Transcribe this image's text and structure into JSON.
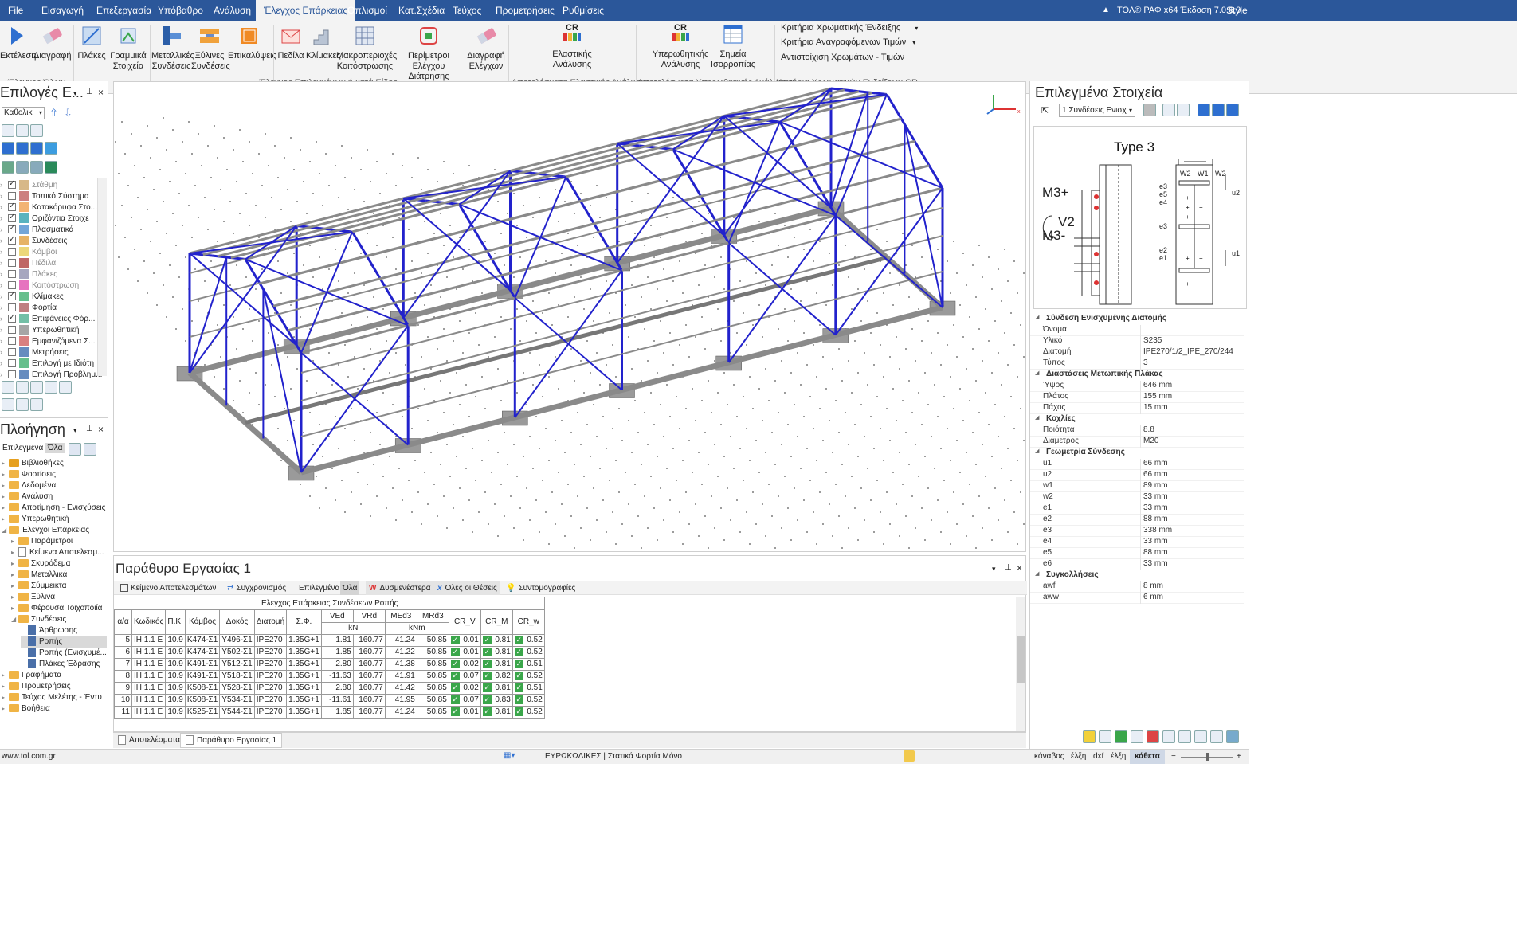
{
  "menu": {
    "items": [
      "File",
      "Εισαγωγή",
      "Επεξεργασία",
      "Υπόβαθρο",
      "Ανάλυση",
      "Έλεγχος Επάρκειας",
      "Οπλισμοί",
      "Κατ.Σχέδια",
      "Τεύχος",
      "Προμετρήσεις",
      "Ρυθμίσεις"
    ],
    "active": "Έλεγχος Επάρκειας",
    "right_title": "ΤΟΛ® ΡΑΦ x64 Έκδοση 7.0.6.0",
    "style_label": "Style"
  },
  "ribbon": {
    "buttons": {
      "run": "Εκτέλεση",
      "delete": "Διαγραφή",
      "slabs": "Πλάκες",
      "linear": "Γραμμικά Στοιχεία",
      "metal_conn": "Μεταλλικές Συνδέσεις",
      "wood_conn": "Ξύλινες Συνδέσεις",
      "overlaps": "Επικαλύψεις",
      "pedila": "Πεδίλα",
      "stairs": "Κλίμακες",
      "macro": "Μακροπεριοχές Κοιτόστρωσης",
      "perimeter": "Περίμετροι Ελέγχου Διάτρησης",
      "delete_checks": "Διαγραφή Ελέγχων",
      "elastic": "Ελαστικής Ανάλυσης",
      "inelastic": "Υπερωθητικής Ανάλυσης",
      "balance": "Σημεία Ισορροπίας"
    },
    "cr_label": "CR",
    "groups": {
      "check_all": "Έλεγχος Όλων",
      "check_selected": "Έλεγχος Επιλεγμένων ή κατά Είδος",
      "elastic_results": "Αποτελέσματα Ελαστικής Ανάλυσης",
      "inelastic_results": "Αποτελέσματα Υπερωθητικής Ανάλυσης",
      "cr_criteria": "Κριτήρια Χρωματικών Ενδείξεων CR"
    },
    "cr_links": [
      "Κριτήρια Χρωματικής Ένδειξης",
      "Κριτήρια Αναγραφόμενων Τιμών",
      "Αντιστοίχιση Χρωμάτων - Τιμών"
    ]
  },
  "left_top": {
    "title": "Επιλογές Ε...",
    "combo": "Καθολικ",
    "layers": [
      {
        "label": "Στάθμη",
        "checked": true,
        "dim": true
      },
      {
        "label": "Τοπικό Σύστημα",
        "checked": false,
        "dim": false
      },
      {
        "label": "Κατακόρυφα Στο...",
        "checked": true,
        "dim": false
      },
      {
        "label": "Οριζόντια Στοιχε",
        "checked": true,
        "dim": false
      },
      {
        "label": "Πλασματικά",
        "checked": true,
        "dim": false
      },
      {
        "label": "Συνδέσεις",
        "checked": true,
        "dim": false
      },
      {
        "label": "Κόμβοι",
        "checked": false,
        "dim": true
      },
      {
        "label": "Πέδιλα",
        "checked": false,
        "dim": true
      },
      {
        "label": "Πλάκες",
        "checked": false,
        "dim": true
      },
      {
        "label": "Κοιτόστρωση",
        "checked": false,
        "dim": true
      },
      {
        "label": "Κλίμακες",
        "checked": true,
        "dim": false
      },
      {
        "label": "Φορτία",
        "checked": false,
        "dim": false
      },
      {
        "label": "Επιφάνειες Φόρ...",
        "checked": true,
        "dim": false
      },
      {
        "label": "Υπερωθητική",
        "checked": false,
        "dim": false
      },
      {
        "label": "Εμφανιζόμενα Σ...",
        "checked": false,
        "dim": false
      },
      {
        "label": "Μετρήσεις",
        "checked": false,
        "dim": false
      },
      {
        "label": "Επιλογή με Ιδιότη",
        "checked": false,
        "dim": false
      },
      {
        "label": "Επιλογή Προβλημ...",
        "checked": false,
        "dim": false
      }
    ]
  },
  "nav": {
    "title": "Πλοήγηση",
    "tab_selected": "Επιλεγμένα",
    "tab_all": "Όλα",
    "items": [
      {
        "label": "Βιβλιοθήκες",
        "lvl": 0
      },
      {
        "label": "Φορτίσεις",
        "lvl": 0
      },
      {
        "label": "Δεδομένα",
        "lvl": 0
      },
      {
        "label": "Ανάλυση",
        "lvl": 0
      },
      {
        "label": "Αποτίμηση - Ενισχύσεις",
        "lvl": 0
      },
      {
        "label": "Υπερωθητική",
        "lvl": 0
      },
      {
        "label": "Έλεγχοι Επάρκειας",
        "lvl": 0
      },
      {
        "label": "Παράμετροι",
        "lvl": 1
      },
      {
        "label": "Κείμενα Αποτελεσμ...",
        "lvl": 1
      },
      {
        "label": "Σκυρόδεμα",
        "lvl": 1
      },
      {
        "label": "Μεταλλικά",
        "lvl": 1
      },
      {
        "label": "Σύμμεικτα",
        "lvl": 1
      },
      {
        "label": "Ξύλινα",
        "lvl": 1
      },
      {
        "label": "Φέρουσα Τοιχοποιία",
        "lvl": 1
      },
      {
        "label": "Συνδέσεις",
        "lvl": 1
      },
      {
        "label": "Άρθρωσης",
        "lvl": 2
      },
      {
        "label": "Ροπής",
        "lvl": 2
      },
      {
        "label": "Ροπής (Ενισχυμέ...",
        "lvl": 2
      },
      {
        "label": "Πλάκες Έδρασης",
        "lvl": 2
      },
      {
        "label": "Γραφήματα",
        "lvl": 0
      },
      {
        "label": "Προμετρήσεις",
        "lvl": 0
      },
      {
        "label": "Τεύχος Μελέτης - Έντυ",
        "lvl": 0
      },
      {
        "label": "Βοήθεια",
        "lvl": 0
      }
    ]
  },
  "work": {
    "title": "Παράθυρο Εργασίας 1",
    "toolbar": [
      "Κείμενο Αποτελεσμάτων",
      "Συγχρονισμός",
      "Επιλεγμένα",
      "Όλα",
      "Δυσμενέστερα",
      "Όλες οι Θέσεις",
      "Συντομογραφίες"
    ],
    "table_title": "Έλεγχος Επάρκειας Συνδέσεων Ροπής",
    "headers": [
      "α/α",
      "Κωδικός",
      "Π.Κ.",
      "Κόμβος",
      "Δοκός",
      "Διατομή",
      "Σ.Φ.",
      "VEd",
      "VRd",
      "MEd3",
      "MRd3",
      "CR_V",
      "CR_M",
      "CR_w"
    ],
    "units": {
      "v": "kN",
      "m": "kNm"
    },
    "rows": [
      [
        "5",
        "IH 1.1 E",
        "10.9",
        "K474-Σ1",
        "Y496-Σ1",
        "IPE270",
        "1.35G+1",
        "1.81",
        "160.77",
        "41.24",
        "50.85",
        "0.01",
        "0.81",
        "0.52"
      ],
      [
        "6",
        "IH 1.1 E",
        "10.9",
        "K474-Σ1",
        "Y502-Σ1",
        "IPE270",
        "1.35G+1",
        "1.85",
        "160.77",
        "41.22",
        "50.85",
        "0.01",
        "0.81",
        "0.52"
      ],
      [
        "7",
        "IH 1.1 E",
        "10.9",
        "K491-Σ1",
        "Y512-Σ1",
        "IPE270",
        "1.35G+1",
        "2.80",
        "160.77",
        "41.38",
        "50.85",
        "0.02",
        "0.81",
        "0.51"
      ],
      [
        "8",
        "IH 1.1 E",
        "10.9",
        "K491-Σ1",
        "Y518-Σ1",
        "IPE270",
        "1.35G+1",
        "-11.63",
        "160.77",
        "41.91",
        "50.85",
        "0.07",
        "0.82",
        "0.52"
      ],
      [
        "9",
        "IH 1.1 E",
        "10.9",
        "K508-Σ1",
        "Y528-Σ1",
        "IPE270",
        "1.35G+1",
        "2.80",
        "160.77",
        "41.42",
        "50.85",
        "0.02",
        "0.81",
        "0.51"
      ],
      [
        "10",
        "IH 1.1 E",
        "10.9",
        "K508-Σ1",
        "Y534-Σ1",
        "IPE270",
        "1.35G+1",
        "-11.61",
        "160.77",
        "41.95",
        "50.85",
        "0.07",
        "0.83",
        "0.52"
      ],
      [
        "11",
        "IH 1.1 E",
        "10.9",
        "K525-Σ1",
        "Y544-Σ1",
        "IPE270",
        "1.35G+1",
        "1.85",
        "160.77",
        "41.24",
        "50.85",
        "0.01",
        "0.81",
        "0.52"
      ]
    ]
  },
  "bottom_tabs": [
    "Αποτελέσματα",
    "Παράθυρο Εργασίας 1"
  ],
  "right": {
    "title": "Επιλεγμένα Στοιχεία",
    "combo": "1 Συνδέσεις Ενισχ",
    "diagram_title": "Type  3",
    "moment_labels": [
      "M3+",
      "V2",
      "M3-"
    ],
    "dim_labels_left": [
      "e3",
      "e5",
      "e4",
      "e3",
      "e2",
      "e1"
    ],
    "dim_labels_top": [
      "W2",
      "W1",
      "W2"
    ],
    "dim_labels_right": [
      "u2",
      "u1"
    ],
    "categories": [
      {
        "name": "Σύνδεση Ενισχυμένης Διατομής",
        "props": [
          [
            "Όνομα",
            ""
          ],
          [
            "Υλικό",
            "S235"
          ],
          [
            "Διατομή",
            "IPE270/1/2_IPE_270/244"
          ],
          [
            "Τύπος",
            "3"
          ]
        ]
      },
      {
        "name": "Διαστάσεις Μετωπικής Πλάκας",
        "props": [
          [
            "Ύψος",
            "646 mm"
          ],
          [
            "Πλάτος",
            "155 mm"
          ],
          [
            "Πάχος",
            "15 mm"
          ]
        ]
      },
      {
        "name": "Κοχλίες",
        "props": [
          [
            "Ποιότητα",
            "8.8"
          ],
          [
            "Διάμετρος",
            "M20"
          ]
        ]
      },
      {
        "name": "Γεωμετρία Σύνδεσης",
        "props": [
          [
            "u1",
            "66 mm"
          ],
          [
            "u2",
            "66 mm"
          ],
          [
            "w1",
            "89 mm"
          ],
          [
            "w2",
            "33 mm"
          ],
          [
            "e1",
            "33 mm"
          ],
          [
            "e2",
            "88 mm"
          ],
          [
            "e3",
            "338 mm"
          ],
          [
            "e4",
            "33 mm"
          ],
          [
            "e5",
            "88 mm"
          ],
          [
            "e6",
            "33 mm"
          ]
        ]
      },
      {
        "name": "Συγκολλήσεις",
        "props": [
          [
            "awf",
            "8 mm"
          ],
          [
            "aww",
            "6 mm"
          ]
        ]
      }
    ]
  },
  "status": {
    "url": "www.tol.com.gr",
    "mode": "ΕΥΡΩΚΩΔΙΚΕΣ | Στατικά Φορτία Μόνο",
    "snaps": [
      "κάναβος",
      "έλξη",
      "dxf",
      "έλξη",
      "κάθετα"
    ]
  },
  "colors": {
    "accent": "#2b579a",
    "frame": "#2222cc",
    "check": "#3aa64a"
  }
}
